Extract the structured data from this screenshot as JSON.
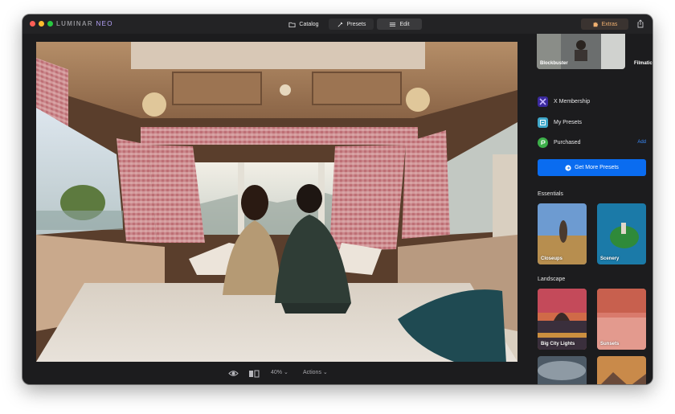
{
  "app": {
    "logo_main": "LUMINAR",
    "logo_accent": "NEO"
  },
  "tabs": [
    {
      "label": "Catalog",
      "icon": "folder-icon"
    },
    {
      "label": "Presets",
      "icon": "sparkle-icon"
    },
    {
      "label": "Edit",
      "icon": "sliders-icon"
    }
  ],
  "toolbar": {
    "extras_label": "Extras",
    "extras_icon": "puzzle-icon",
    "share_icon": "share-icon"
  },
  "bottom_bar": {
    "zoom_value": "40%",
    "actions_label": "Actions",
    "preview_icon": "eye-icon",
    "compare_icon": "compare-icon"
  },
  "sidebar": {
    "featured": [
      {
        "label": "Blockbuster"
      },
      {
        "label": "Filmatic"
      }
    ],
    "menu": [
      {
        "label": "X Membership",
        "icon": "membership-icon"
      },
      {
        "label": "My Presets",
        "icon": "my-presets-icon"
      },
      {
        "label": "Purchased",
        "icon": "purchased-icon",
        "action": "Add"
      }
    ],
    "cta": "Get More Presets",
    "sections": [
      {
        "title": "Essentials",
        "items": [
          {
            "label": "Closeups"
          },
          {
            "label": "Scenery"
          }
        ]
      },
      {
        "title": "Landscape",
        "items": [
          {
            "label": "Big City Lights"
          },
          {
            "label": "Sunsets"
          },
          {
            "label": ""
          },
          {
            "label": ""
          }
        ]
      }
    ]
  },
  "colors": {
    "window_bg": "#1c1c1e",
    "accent_blue": "#0a6cf0",
    "extras_orange": "#f0b070",
    "link_blue": "#3a8dff"
  }
}
